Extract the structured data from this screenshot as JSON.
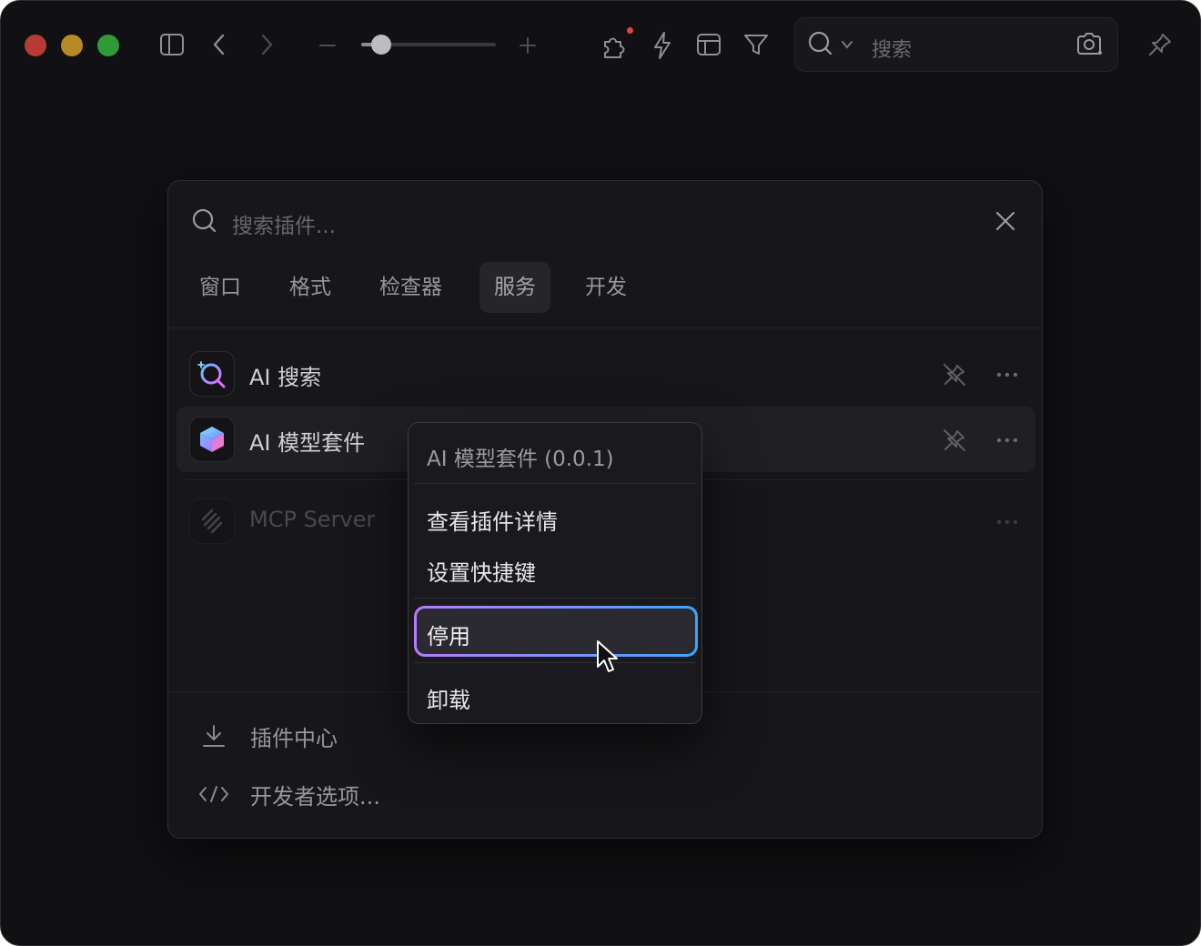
{
  "toolbar": {
    "search_placeholder": "搜索",
    "zoom_level": 0.15,
    "has_notification": true
  },
  "plugin_panel": {
    "search_placeholder": "搜索插件...",
    "tabs": [
      {
        "label": "窗口",
        "active": false
      },
      {
        "label": "格式",
        "active": false
      },
      {
        "label": "检查器",
        "active": false
      },
      {
        "label": "服务",
        "active": true
      },
      {
        "label": "开发",
        "active": false
      }
    ],
    "plugins": [
      {
        "label": "AI 搜索",
        "icon": "ai-search-icon",
        "enabled": true,
        "hovered": false
      },
      {
        "label": "AI 模型套件",
        "icon": "ai-model-cube-icon",
        "enabled": true,
        "hovered": true
      },
      {
        "label": "MCP Server",
        "icon": "mcp-server-icon",
        "enabled": false,
        "hovered": false
      }
    ],
    "footer": {
      "plugin_center": "插件中心",
      "developer_options": "开发者选项..."
    }
  },
  "context_menu": {
    "title": "AI 模型套件 (0.0.1)",
    "items": [
      "查看插件详情",
      "设置快捷键",
      "停用",
      "卸载"
    ],
    "highlighted": "停用"
  },
  "colors": {
    "window_bg": "#111114",
    "panel_bg": "#17171a",
    "close": "#b63a36",
    "minimize": "#b88a26",
    "maximize": "#2e9a3a",
    "highlight_gradient_start": "#b47cff",
    "highlight_gradient_end": "#3aa6ff"
  }
}
